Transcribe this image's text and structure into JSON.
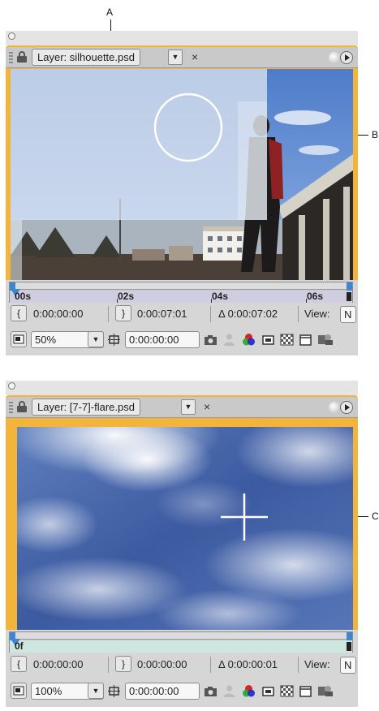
{
  "callouts": {
    "a": "A",
    "b": "B",
    "c": "C"
  },
  "panels": [
    {
      "tab_label": "Layer: silhouette.psd",
      "ruler_ticks": [
        "00s",
        "02s",
        "04s",
        "06s"
      ],
      "in_point": "0:00:00:00",
      "out_point": "0:00:07:01",
      "duration": "Δ 0:00:07:02",
      "view_label": "View:",
      "view_value": "N",
      "zoom": "50%",
      "current_time": "0:00:00:00"
    },
    {
      "tab_label": "Layer: [7-7]-flare.psd",
      "ruler_ticks": [
        "0f"
      ],
      "in_point": "0:00:00:00",
      "out_point": "0:00:00:00",
      "duration": "Δ 0:00:00:01",
      "view_label": "View:",
      "view_value": "N",
      "zoom": "100%",
      "current_time": "0:00:00:00"
    }
  ],
  "icons": {
    "panel_menu": "flyout-menu-icon",
    "lock": "lock-icon",
    "dropdown": "dropdown-arrow-icon",
    "close": "close-icon",
    "in_point": "set-in-point-icon",
    "out_point": "set-out-point-icon",
    "always_preview": "always-preview-icon",
    "region": "region-of-interest-icon",
    "snapshot": "camera-snapshot-icon",
    "show_snapshot": "show-snapshot-icon",
    "channels": "rgb-channels-icon",
    "resolution": "resolution-icon",
    "transparency": "transparency-grid-icon",
    "guides": "guides-icon",
    "fast_preview": "fast-previews-icon"
  },
  "colors": {
    "frame": "#f2b43a",
    "playhead": "#3e86cf",
    "sky": "#3f5c9e"
  }
}
